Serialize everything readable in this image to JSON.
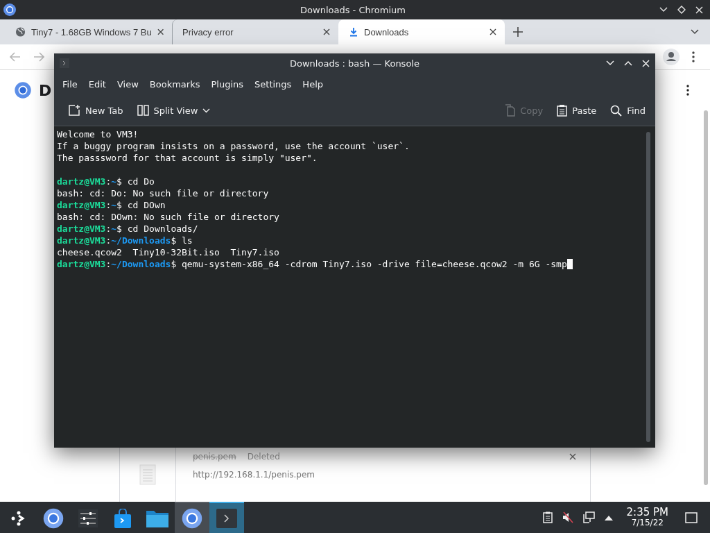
{
  "browser": {
    "title": "Downloads - Chromium",
    "tabs": [
      {
        "label": "Tiny7 - 1.68GB Windows 7 Bu",
        "selected": false
      },
      {
        "label": "Privacy error",
        "selected": false
      },
      {
        "label": "Downloads",
        "selected": true
      }
    ],
    "page": {
      "heading": "D",
      "download": {
        "name": "penis.pem",
        "status": "Deleted",
        "url": "http://192.168.1.1/penis.pem"
      }
    }
  },
  "konsole": {
    "title": "Downloads : bash — Konsole",
    "menu": [
      "File",
      "Edit",
      "View",
      "Bookmarks",
      "Plugins",
      "Settings",
      "Help"
    ],
    "toolbar_left": [
      {
        "label": "New Tab"
      },
      {
        "label": "Split View"
      }
    ],
    "toolbar_right": [
      {
        "label": "Copy",
        "disabled": true
      },
      {
        "label": "Paste",
        "disabled": false
      },
      {
        "label": "Find",
        "disabled": false
      }
    ],
    "lines": [
      {
        "blank_before": false,
        "cursor": false,
        "segments": [
          {
            "kind": "plain",
            "text": "Welcome to VM3!"
          }
        ]
      },
      {
        "blank_before": false,
        "cursor": false,
        "segments": [
          {
            "kind": "plain",
            "text": "If a buggy program insists on a password, use the account `user`."
          }
        ]
      },
      {
        "blank_before": false,
        "cursor": false,
        "segments": [
          {
            "kind": "plain",
            "text": "The passsword for that account is simply \"user\"."
          }
        ]
      },
      {
        "blank_before": true,
        "cursor": false,
        "segments": [
          {
            "kind": "user",
            "text": "dartz@VM3"
          },
          {
            "kind": "plain",
            "text": ":"
          },
          {
            "kind": "path",
            "text": "~"
          },
          {
            "kind": "plain",
            "text": "$ cd Do"
          }
        ]
      },
      {
        "blank_before": false,
        "cursor": false,
        "segments": [
          {
            "kind": "plain",
            "text": "bash: cd: Do: No such file or directory"
          }
        ]
      },
      {
        "blank_before": false,
        "cursor": false,
        "segments": [
          {
            "kind": "user",
            "text": "dartz@VM3"
          },
          {
            "kind": "plain",
            "text": ":"
          },
          {
            "kind": "path",
            "text": "~"
          },
          {
            "kind": "plain",
            "text": "$ cd DOwn"
          }
        ]
      },
      {
        "blank_before": false,
        "cursor": false,
        "segments": [
          {
            "kind": "plain",
            "text": "bash: cd: DOwn: No such file or directory"
          }
        ]
      },
      {
        "blank_before": false,
        "cursor": false,
        "segments": [
          {
            "kind": "user",
            "text": "dartz@VM3"
          },
          {
            "kind": "plain",
            "text": ":"
          },
          {
            "kind": "path",
            "text": "~"
          },
          {
            "kind": "plain",
            "text": "$ cd Downloads/"
          }
        ]
      },
      {
        "blank_before": false,
        "cursor": false,
        "segments": [
          {
            "kind": "user",
            "text": "dartz@VM3"
          },
          {
            "kind": "plain",
            "text": ":"
          },
          {
            "kind": "path",
            "text": "~/Downloads"
          },
          {
            "kind": "plain",
            "text": "$ ls"
          }
        ]
      },
      {
        "blank_before": false,
        "cursor": false,
        "segments": [
          {
            "kind": "plain",
            "text": "cheese.qcow2  Tiny10-32Bit.iso  Tiny7.iso"
          }
        ]
      },
      {
        "blank_before": false,
        "cursor": true,
        "segments": [
          {
            "kind": "user",
            "text": "dartz@VM3"
          },
          {
            "kind": "plain",
            "text": ":"
          },
          {
            "kind": "path",
            "text": "~/Downloads"
          },
          {
            "kind": "plain",
            "text": "$ qemu-system-x86_64 -cdrom Tiny7.iso -drive file=cheese.qcow2 -m 6G -smp"
          }
        ]
      }
    ]
  },
  "taskbar": {
    "items": [
      {
        "open": false,
        "focused": false
      },
      {
        "open": false,
        "focused": false
      },
      {
        "open": false,
        "focused": false
      },
      {
        "open": false,
        "focused": false
      },
      {
        "open": false,
        "focused": false
      },
      {
        "open": true,
        "focused": false
      },
      {
        "open": true,
        "focused": true
      }
    ],
    "time": "2:35 PM",
    "date": "7/15/22"
  }
}
